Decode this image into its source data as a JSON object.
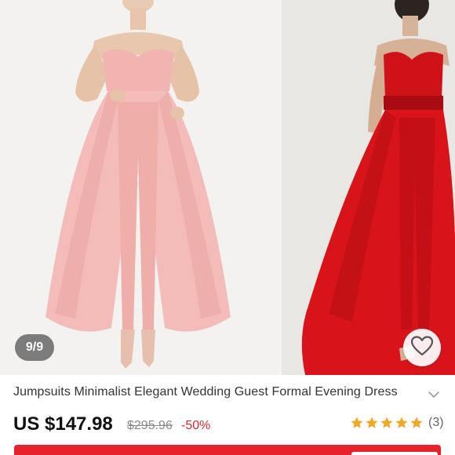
{
  "gallery": {
    "counter": "9/9",
    "favorite_icon": "heart-outline-icon"
  },
  "product": {
    "title": "Jumpsuits Minimalist Elegant Wedding Guest Formal Evening Dress",
    "expand_icon": "chevron-down-icon",
    "price": "US $147.98",
    "original_price": "$295.96",
    "discount": "-50%",
    "rating_stars": 5,
    "review_count": "(3)"
  },
  "colors": {
    "accent_red": "#e8222c",
    "discount_red": "#e0262f",
    "star_orange": "#f5a623",
    "pink_dress": "#f3b6b4",
    "red_dress": "#d8141a"
  }
}
